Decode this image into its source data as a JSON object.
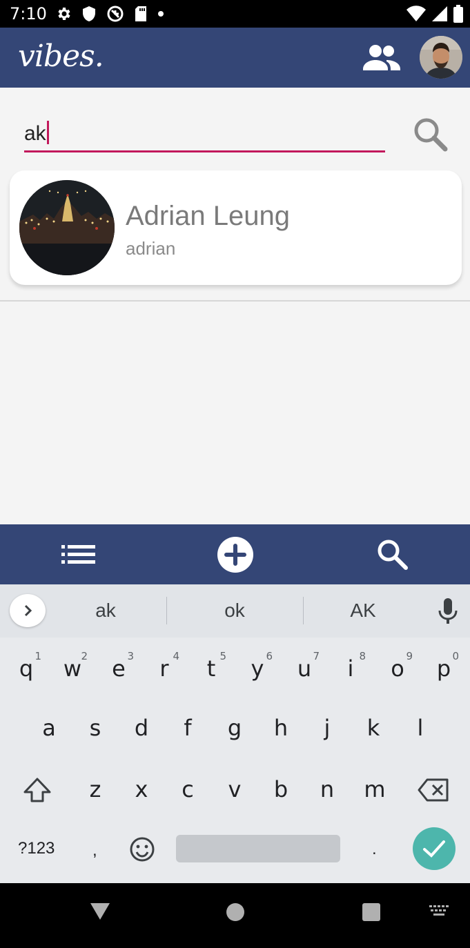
{
  "status_bar": {
    "time": "7:10",
    "left_icons": [
      "gear-icon",
      "shield-icon",
      "data-saver-icon",
      "sd-card-icon",
      "dot-icon"
    ],
    "right_icons": [
      "wifi-icon",
      "signal-icon",
      "battery-icon"
    ]
  },
  "header": {
    "logo_text": "vibes.",
    "background": "#344676",
    "friends_icon": "group-icon"
  },
  "search": {
    "value": "ak",
    "accent": "#c2185b",
    "button_icon": "search-icon"
  },
  "results": [
    {
      "name": "Adrian Leung",
      "username": "adrian"
    }
  ],
  "bottom_nav": {
    "items": [
      "list-icon",
      "add-circle-icon",
      "search-icon"
    ]
  },
  "keyboard": {
    "suggestions": [
      "ak",
      "ok",
      "AK"
    ],
    "row1": [
      {
        "key": "q",
        "hint": "1"
      },
      {
        "key": "w",
        "hint": "2"
      },
      {
        "key": "e",
        "hint": "3"
      },
      {
        "key": "r",
        "hint": "4"
      },
      {
        "key": "t",
        "hint": "5"
      },
      {
        "key": "y",
        "hint": "6"
      },
      {
        "key": "u",
        "hint": "7"
      },
      {
        "key": "i",
        "hint": "8"
      },
      {
        "key": "o",
        "hint": "9"
      },
      {
        "key": "p",
        "hint": "0"
      }
    ],
    "row2": [
      "a",
      "s",
      "d",
      "f",
      "g",
      "h",
      "j",
      "k",
      "l"
    ],
    "row3": [
      "z",
      "x",
      "c",
      "v",
      "b",
      "n",
      "m"
    ],
    "sym_label": "?123",
    "comma": ",",
    "period": ".",
    "enter_color": "#4db6ac"
  }
}
